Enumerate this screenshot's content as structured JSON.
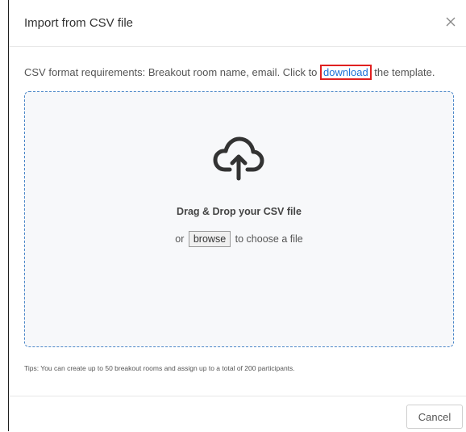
{
  "dialog": {
    "title": "Import from CSV file",
    "close_icon": "close-icon"
  },
  "requirements": {
    "prefix": "CSV format requirements: Breakout room name, email. Click to ",
    "link": "download",
    "suffix": " the template."
  },
  "dropzone": {
    "icon": "cloud-upload-icon",
    "heading": "Drag & Drop your CSV file",
    "or_label": "or",
    "browse_label": "browse",
    "after_browse": "to choose a file"
  },
  "tips": "Tips: You can create up to 50 breakout rooms and assign up to a total of 200 participants.",
  "footer": {
    "cancel_label": "Cancel"
  },
  "colors": {
    "link": "#1a6fd6",
    "highlight_border": "#e02020",
    "dropzone_border": "#4a86c8",
    "dropzone_bg": "#f7f8fa"
  }
}
